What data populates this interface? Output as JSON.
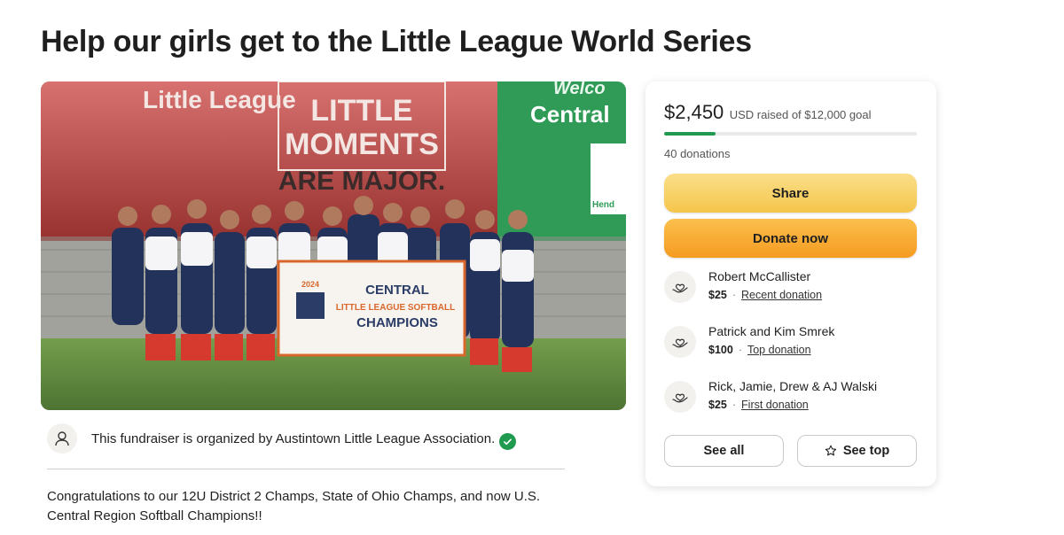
{
  "page": {
    "title": "Help our girls get to the Little League World Series"
  },
  "hero": {
    "banner_brand": "Little League",
    "banner_slogan_1": "LITTLE",
    "banner_slogan_2": "MOMENTS",
    "banner_slogan_3": "ARE MAJOR.",
    "banner_welcome": "Welco",
    "banner_central": "Central",
    "banner_sponsor": "Hend",
    "flag_year": "2024",
    "flag_line_1": "CENTRAL",
    "flag_line_2": "LITTLE LEAGUE SOFTBALL",
    "flag_line_3": "CHAMPIONS"
  },
  "organizer": {
    "text": "This fundraiser is organized by Austintown Little League Association."
  },
  "story": {
    "text": "Congratulations to our 12U District 2 Champs, State of Ohio Champs, and now U.S. Central Region Softball Champions!!"
  },
  "donation_card": {
    "raised_amount": "$2,450",
    "raised_text": "USD raised of $12,000 goal",
    "progress_fraction": 0.204,
    "donation_count": "40 donations",
    "share_label": "Share",
    "donate_label": "Donate now",
    "donors": [
      {
        "name": "Robert McCallister",
        "amount": "$25",
        "tag": "Recent donation"
      },
      {
        "name": "Patrick and Kim Smrek",
        "amount": "$100",
        "tag": "Top donation"
      },
      {
        "name": "Rick, Jamie, Drew & AJ Walski",
        "amount": "$25",
        "tag": "First donation"
      }
    ],
    "see_all_label": "See all",
    "see_top_label": "See top"
  },
  "colors": {
    "accent_green": "#1f9a4e",
    "share_yellow": "#f5c54a",
    "donate_orange": "#f59b21"
  },
  "icons": {
    "organizer_avatar": "person-icon",
    "verified": "check-circle-icon",
    "donor": "heart-hand-icon",
    "see_top": "star-icon"
  }
}
